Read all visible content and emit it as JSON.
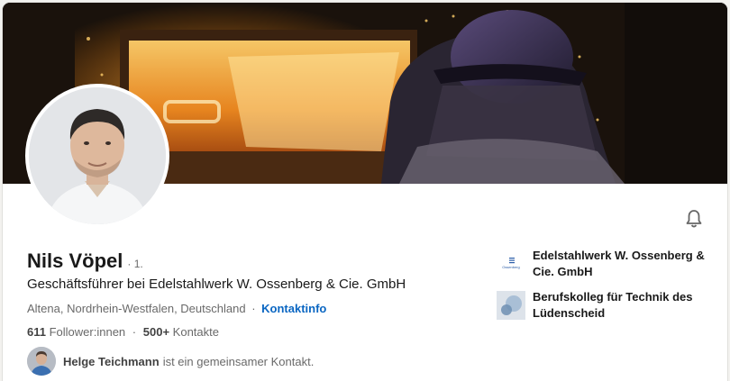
{
  "profile": {
    "name": "Nils Vöpel",
    "degree": "· 1.",
    "headline": "Geschäftsführer bei Edelstahlwerk W. Ossenberg & Cie. GmbH",
    "location": "Altena, Nordrhein-Westfalen, Deutschland",
    "location_separator": "·",
    "contact_info": "Kontaktinfo",
    "followers_count": "611",
    "followers_label": "Follower:innen",
    "stats_separator": "·",
    "connections_count": "500+",
    "connections_label": "Kontakte",
    "mutual_name": "Helge Teichmann",
    "mutual_text": "ist ein gemeinsamer Kontakt."
  },
  "organizations": [
    {
      "name": "Edelstahlwerk W. Ossenberg & Cie. GmbH",
      "logo_icon": "ossenberg-logo-icon",
      "logo_text": "Ossenberg"
    },
    {
      "name": "Berufskolleg für Technik des Lüdenscheid",
      "logo_icon": "school-logo-icon"
    }
  ],
  "icons": {
    "notification": "bell-icon"
  },
  "colors": {
    "link": "#0a66c2",
    "background": "#f3f2ef",
    "card": "#ffffff"
  }
}
